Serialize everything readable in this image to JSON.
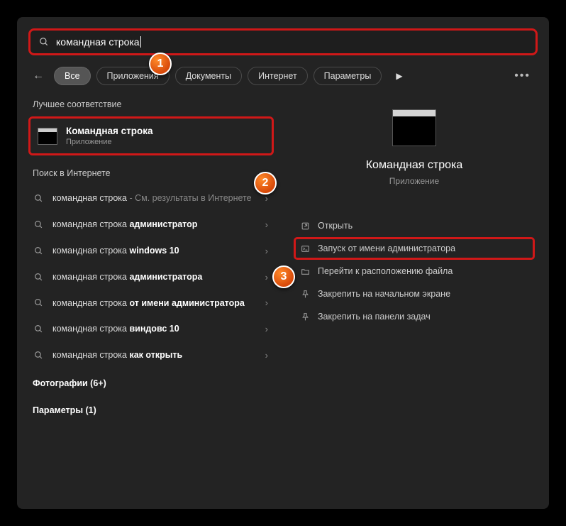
{
  "search": {
    "value": "командная строка"
  },
  "filters": {
    "items": [
      "Все",
      "Приложения",
      "Документы",
      "Интернет",
      "Параметры"
    ]
  },
  "sections": {
    "best_match": "Лучшее соответствие",
    "web": "Поиск в Интернете",
    "photos": "Фотографии (6+)",
    "params": "Параметры (1)"
  },
  "best": {
    "title": "Командная строка",
    "sub": "Приложение"
  },
  "web_items": [
    {
      "prefix": "командная строка",
      "bold": "",
      "suffix": " - См. результаты в Интернете",
      "dim_suffix": true
    },
    {
      "prefix": "командная строка ",
      "bold": "администратор",
      "suffix": ""
    },
    {
      "prefix": "командная строка ",
      "bold": "windows 10",
      "suffix": ""
    },
    {
      "prefix": "командная строка ",
      "bold": "администратора",
      "suffix": ""
    },
    {
      "prefix": "командная строка ",
      "bold": "от имени администратора",
      "suffix": ""
    },
    {
      "prefix": "командная строка ",
      "bold": "виндовс 10",
      "suffix": ""
    },
    {
      "prefix": "командная строка ",
      "bold": "как открыть",
      "suffix": ""
    }
  ],
  "preview": {
    "title": "Командная строка",
    "sub": "Приложение"
  },
  "actions": [
    {
      "label": "Открыть",
      "icon": "open"
    },
    {
      "label": "Запуск от имени администратора",
      "icon": "admin",
      "hl": true
    },
    {
      "label": "Перейти к расположению файла",
      "icon": "folder"
    },
    {
      "label": "Закрепить на начальном экране",
      "icon": "pin"
    },
    {
      "label": "Закрепить на панели задач",
      "icon": "pin"
    }
  ],
  "callouts": {
    "1": "1",
    "2": "2",
    "3": "3"
  }
}
